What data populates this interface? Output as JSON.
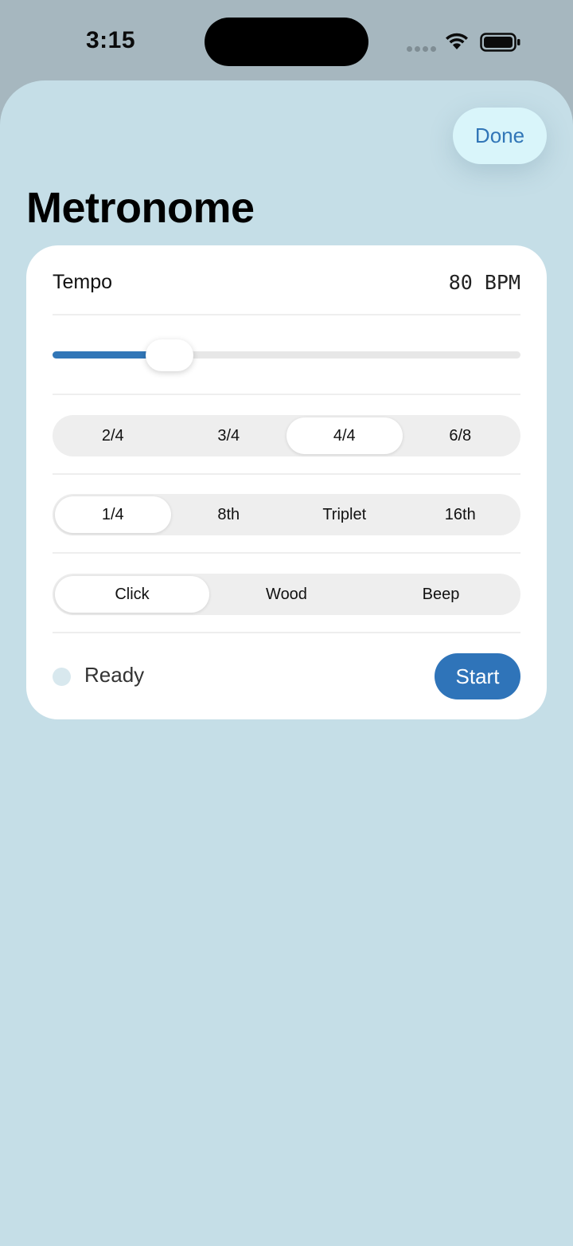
{
  "status_bar": {
    "time": "3:15",
    "icons": [
      "cellular-signal-icon",
      "wifi-icon",
      "battery-icon"
    ]
  },
  "header": {
    "done_label": "Done",
    "title": "Metronome"
  },
  "tempo": {
    "label": "Tempo",
    "value_text": "80 BPM",
    "slider_fraction": 0.25
  },
  "time_signature": {
    "options": [
      "2/4",
      "3/4",
      "4/4",
      "6/8"
    ],
    "selected": "4/4"
  },
  "subdivision": {
    "options": [
      "1/4",
      "8th",
      "Triplet",
      "16th"
    ],
    "selected": "1/4"
  },
  "sound": {
    "options": [
      "Click",
      "Wood",
      "Beep"
    ],
    "selected": "Click"
  },
  "footer": {
    "status_text": "Ready",
    "start_label": "Start"
  },
  "colors": {
    "accent": "#3176b7",
    "sheet_background": "#c5dee7",
    "card_background": "#ffffff",
    "done_background": "#d9f5fa"
  }
}
